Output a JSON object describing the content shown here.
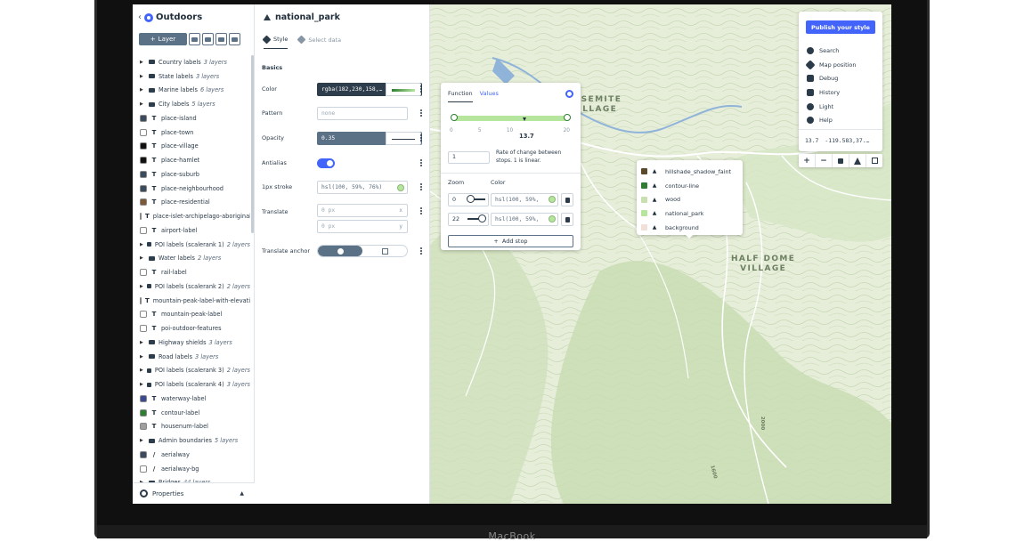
{
  "device": {
    "brand": "MacBook"
  },
  "style": {
    "name": "Outdoors",
    "add_layer_label": "Layer"
  },
  "layers": [
    {
      "kind": "group",
      "name": "Country labels",
      "count": "3 layers"
    },
    {
      "kind": "group",
      "name": "State labels",
      "count": "3 layers"
    },
    {
      "kind": "group",
      "name": "Marine labels",
      "count": "6 layers"
    },
    {
      "kind": "group",
      "name": "City labels",
      "count": "5 layers"
    },
    {
      "kind": "symbol",
      "name": "place-island",
      "color": "#3b4a5e"
    },
    {
      "kind": "symbol",
      "name": "place-town",
      "color": "#ffffff"
    },
    {
      "kind": "symbol",
      "name": "place-village",
      "color": "#111111"
    },
    {
      "kind": "symbol",
      "name": "place-hamlet",
      "color": "#111111"
    },
    {
      "kind": "symbol",
      "name": "place-suburb",
      "color": "#3b4a5e"
    },
    {
      "kind": "symbol",
      "name": "place-neighbourhood",
      "color": "#3b4a5e"
    },
    {
      "kind": "symbol",
      "name": "place-residential",
      "color": "#7a5a3a"
    },
    {
      "kind": "symbol",
      "name": "place-islet-archipelago-aboriginal",
      "color": "#3b4a5e"
    },
    {
      "kind": "symbol",
      "name": "airport-label",
      "color": "#ffffff"
    },
    {
      "kind": "group",
      "name": "POI labels (scalerank 1)",
      "count": "2 layers"
    },
    {
      "kind": "group",
      "name": "Water labels",
      "count": "2 layers"
    },
    {
      "kind": "symbol",
      "name": "rail-label",
      "color": "#ffffff"
    },
    {
      "kind": "group",
      "name": "POI labels (scalerank 2)",
      "count": "2 layers"
    },
    {
      "kind": "symbol",
      "name": "mountain-peak-label-with-elevation",
      "color": "#ffffff"
    },
    {
      "kind": "symbol",
      "name": "mountain-peak-label",
      "color": "#ffffff"
    },
    {
      "kind": "symbol",
      "name": "poi-outdoor-features",
      "color": "#ffffff"
    },
    {
      "kind": "group",
      "name": "Highway shields",
      "count": "3 layers"
    },
    {
      "kind": "group",
      "name": "Road labels",
      "count": "3 layers"
    },
    {
      "kind": "group",
      "name": "POI labels (scalerank 3)",
      "count": "2 layers"
    },
    {
      "kind": "group",
      "name": "POI labels (scalerank 4)",
      "count": "3 layers"
    },
    {
      "kind": "symbol",
      "name": "waterway-label",
      "color": "#3b4a8e"
    },
    {
      "kind": "symbol",
      "name": "contour-label",
      "color": "#2e7d32"
    },
    {
      "kind": "symbol",
      "name": "housenum-label",
      "color": "#9e9e9e"
    },
    {
      "kind": "group",
      "name": "Admin boundaries",
      "count": "5 layers"
    },
    {
      "kind": "line",
      "name": "aerialway",
      "color": "#3b4a5e"
    },
    {
      "kind": "line",
      "name": "aerialway-bg",
      "color": "#ffffff"
    },
    {
      "kind": "group",
      "name": "Bridges",
      "count": "44 layers"
    }
  ],
  "footer": {
    "properties_label": "Properties"
  },
  "editor": {
    "layer_name": "national_park",
    "tabs": {
      "style": "Style",
      "select_data": "Select data"
    },
    "section": "Basics",
    "color": {
      "label": "Color",
      "value": "rgba(182,230,158,…"
    },
    "pattern": {
      "label": "Pattern",
      "placeholder": "none"
    },
    "opacity": {
      "label": "Opacity",
      "value": "0.35"
    },
    "antialias": {
      "label": "Antialias",
      "on": true
    },
    "stroke": {
      "label": "1px stroke",
      "value": "hsl(100, 59%, 76%)"
    },
    "translate": {
      "label": "Translate",
      "x": "0 px",
      "y": "0 px",
      "x_unit": "x",
      "y_unit": "y"
    },
    "translate_anchor": {
      "label": "Translate anchor"
    }
  },
  "function_popup": {
    "tabs": [
      "Function",
      "Values"
    ],
    "ticks": [
      "0",
      "5",
      "10",
      "",
      "20"
    ],
    "current_zoom": "13.7",
    "rate": "1",
    "rate_text": "Rate of change between stops. 1 is linear.",
    "headers": {
      "zoom": "Zoom",
      "color": "Color"
    },
    "stops": [
      {
        "zoom": "0",
        "color": "hsl(100, 59%,",
        "zoom_fraction": 0.0
      },
      {
        "zoom": "22",
        "color": "hsl(100, 59%,",
        "zoom_fraction": 1.0
      }
    ],
    "add_stop": "Add stop"
  },
  "legend": [
    {
      "name": "hillshade_shadow_faint",
      "color": "#5a4a2a"
    },
    {
      "name": "contour-line",
      "color": "#2e7d32"
    },
    {
      "name": "wood",
      "color": "#c8e0b0"
    },
    {
      "name": "national_park",
      "color": "#b6e69e"
    },
    {
      "name": "background",
      "color": "#f0e0d8"
    }
  ],
  "map": {
    "labels": {
      "yosemite": "YOSEMITE\nVILLAGE",
      "half_dome": "HALF DOME\nVILLAGE",
      "road_1": "1600",
      "road_2": "2000"
    }
  },
  "right_panel": {
    "publish": "Publish your style",
    "items": [
      "Search",
      "Map position",
      "Debug",
      "History",
      "Light",
      "Help"
    ],
    "zoom": "13.7",
    "coords": "-119.583,37.…"
  }
}
